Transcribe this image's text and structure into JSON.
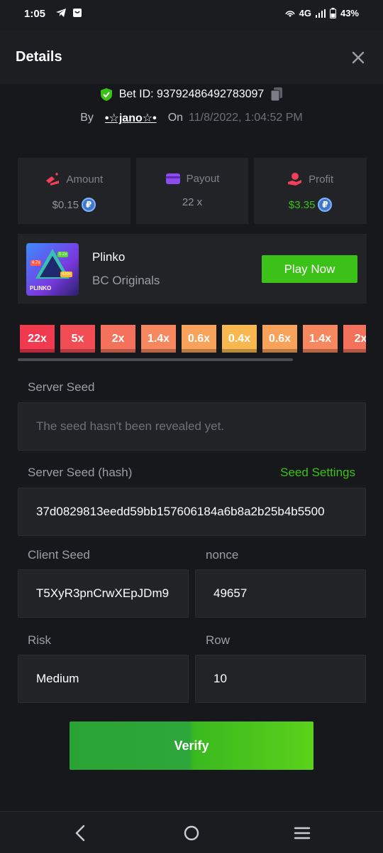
{
  "status_bar": {
    "time": "1:05",
    "network": "4G",
    "battery": "43%",
    "icons": [
      "telegram-icon",
      "app-notification-icon",
      "hotspot-icon",
      "signal-icon",
      "battery-icon"
    ]
  },
  "header": {
    "title": "Details",
    "close_icon": "close-icon"
  },
  "bet": {
    "id_label": "Bet ID: 93792486492783097",
    "by_label": "By",
    "user": "•☆jano☆•",
    "on_label": "On",
    "date": "11/8/2022, 1:04:52 PM"
  },
  "stats": [
    {
      "label": "Amount",
      "value": "$0.15",
      "icon": "amount-icon",
      "coin": true,
      "value_color": "#8f939b"
    },
    {
      "label": "Payout",
      "value": "22 x",
      "icon": "wallet-icon",
      "coin": false,
      "value_color": "#8f939b"
    },
    {
      "label": "Profit",
      "value": "$3.35",
      "icon": "profit-icon",
      "coin": true,
      "value_color": "#3bc117"
    }
  ],
  "coin_symbol": "₽",
  "game": {
    "name": "Plinko",
    "provider": "BC Originals",
    "play_label": "Play Now",
    "thumb_label": "PLINKO",
    "thumb_tags": [
      "4.7x",
      "0.2x",
      "420x"
    ]
  },
  "multipliers": [
    {
      "label": "22x",
      "color": "#f1394f"
    },
    {
      "label": "5x",
      "color": "#f24d55"
    },
    {
      "label": "2x",
      "color": "#f4725b"
    },
    {
      "label": "1.4x",
      "color": "#f6875e"
    },
    {
      "label": "0.6x",
      "color": "#f8a25a"
    },
    {
      "label": "0.4x",
      "color": "#f9b84f"
    },
    {
      "label": "0.6x",
      "color": "#f8a25a"
    },
    {
      "label": "1.4x",
      "color": "#f6875e"
    },
    {
      "label": "2x",
      "color": "#f4725b"
    }
  ],
  "form": {
    "server_seed_label": "Server Seed",
    "server_seed_value": "The seed hasn't been revealed yet.",
    "server_hash_label": "Server Seed (hash)",
    "seed_settings_label": "Seed Settings",
    "server_hash_value": "37d0829813eedd59bb157606184a6b8a2b25b4b5500",
    "client_seed_label": "Client Seed",
    "client_seed_value": "T5XyR3pnCrwXEpJDm9",
    "nonce_label": "nonce",
    "nonce_value": "49657",
    "risk_label": "Risk",
    "risk_value": "Medium",
    "row_label": "Row",
    "row_value": "10",
    "verify_label": "Verify"
  },
  "navbar": {
    "icons": [
      "back-icon",
      "home-icon",
      "recents-icon"
    ]
  },
  "colors": {
    "accent_green": "#3bc117",
    "background": "#17181b",
    "card": "#222327"
  }
}
